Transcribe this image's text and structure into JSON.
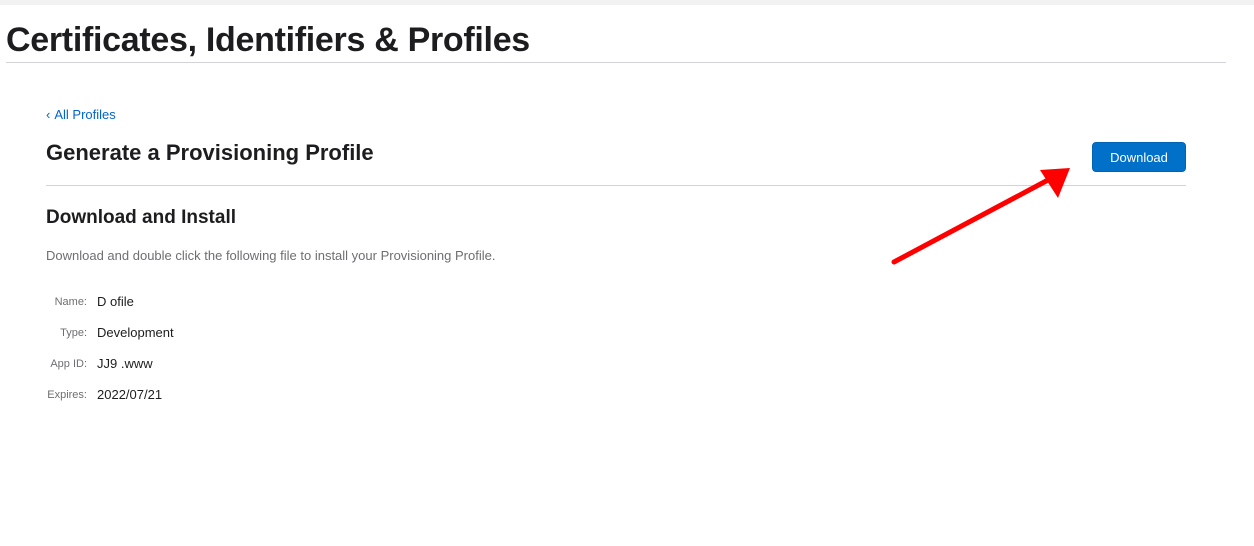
{
  "page": {
    "title": "Certificates, Identifiers & Profiles"
  },
  "breadcrumb": {
    "back_label": "All Profiles",
    "chevron": "‹"
  },
  "section": {
    "title": "Generate a Provisioning Profile",
    "download_label": "Download"
  },
  "install": {
    "title": "Download and Install",
    "description": "Download and double click the following file to install your Provisioning Profile."
  },
  "details": [
    {
      "label": "Name:",
      "value": "D           ofile"
    },
    {
      "label": "Type:",
      "value": "Development"
    },
    {
      "label": "App ID:",
      "value": "JJ9                     .www"
    },
    {
      "label": "Expires:",
      "value": "2022/07/21"
    }
  ],
  "annotation": {
    "arrow_color": "#ff0000",
    "arrow_icon": "red-arrow-annotation"
  },
  "colors": {
    "link": "#0066cc",
    "button": "#0070c9",
    "text": "#1d1d1f",
    "muted": "#6e6e73"
  }
}
